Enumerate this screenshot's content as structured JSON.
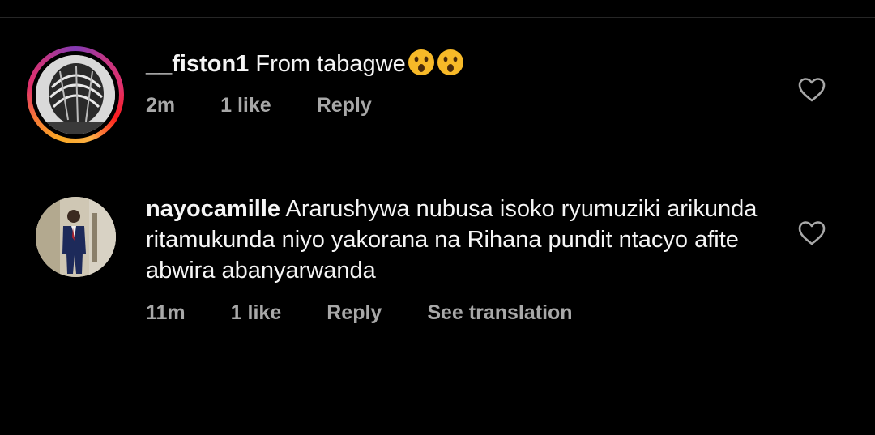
{
  "comments": [
    {
      "username": "__fiston1",
      "text": "From tabagwe",
      "emojis": [
        "astonished-face-emoji",
        "astonished-face-emoji"
      ],
      "time": "2m",
      "likes": "1 like",
      "reply": "Reply",
      "has_story_ring": true
    },
    {
      "username": "nayocamille",
      "text": "Ararushywa nubusa isoko ryumuziki arikunda ritamukunda niyo yakorana na Rihana pundit ntacyo afite abwira abanyarwanda",
      "time": "11m",
      "likes": "1 like",
      "reply": "Reply",
      "translate": "See translation",
      "has_story_ring": false
    }
  ],
  "colors": {
    "background": "#000000",
    "primary_text": "#f5f5f5",
    "secondary_text": "#a8a8a8",
    "divider": "#262626"
  }
}
